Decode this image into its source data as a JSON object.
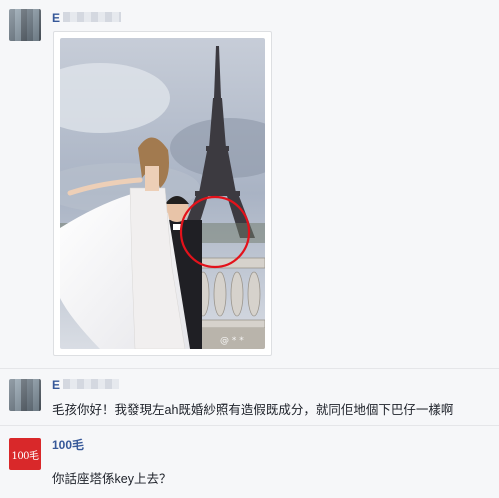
{
  "post": {
    "author_initial": "E",
    "watermark": "@ * *"
  },
  "comments": [
    {
      "author_initial": "E",
      "text": "毛孩你好！我發現左ah既婚紗照有造假既成分，就同佢地個下巴仔一樣啊"
    },
    {
      "author": "100毛",
      "avatar_text": "100毛",
      "text": "你話座塔係key上去？"
    }
  ],
  "colors": {
    "name": "#365899",
    "annotation_circle": "#e3121b",
    "avatar_red": "#d9282a"
  }
}
